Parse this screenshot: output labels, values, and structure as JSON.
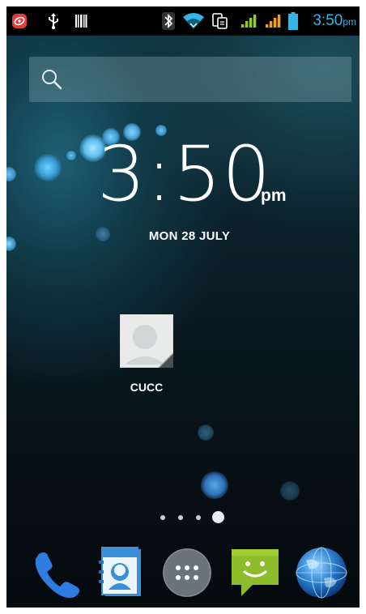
{
  "status_bar": {
    "time": "3:50",
    "ampm": "pm",
    "icons": [
      "notification-app-icon",
      "usb-icon",
      "barcode-icon",
      "bluetooth-icon",
      "wifi-icon",
      "data-transfer-icon",
      "signal-1-icon",
      "signal-2-icon",
      "battery-icon"
    ],
    "accent_color": "#33b5e5"
  },
  "search": {
    "icon": "search-icon"
  },
  "clock": {
    "time": "3:50",
    "ampm": "pm",
    "date": "MON 28 JULY"
  },
  "shortcut": {
    "label": "CUCC",
    "icon": "contact-icon"
  },
  "page_indicator": {
    "pages": 4,
    "current": 4
  },
  "dock": {
    "items": [
      {
        "icon": "phone-icon"
      },
      {
        "icon": "contacts-icon"
      },
      {
        "icon": "app-drawer-icon"
      },
      {
        "icon": "messaging-icon"
      },
      {
        "icon": "browser-globe-icon"
      }
    ]
  }
}
